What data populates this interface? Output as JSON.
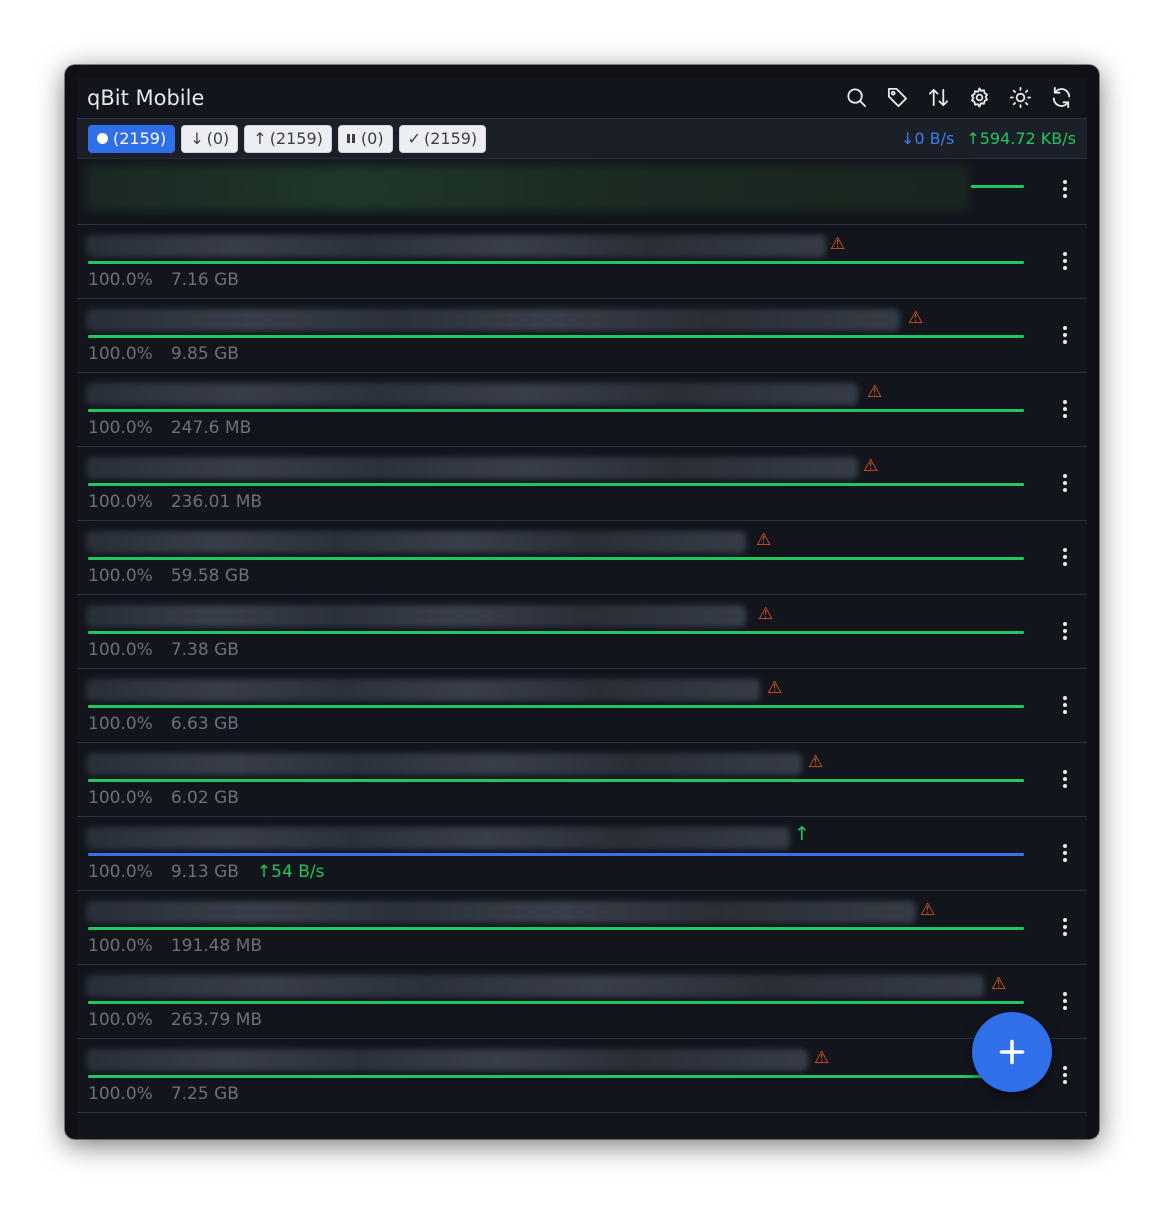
{
  "app": {
    "title": "qBit Mobile"
  },
  "toolbar": {
    "icons": [
      "search-icon",
      "tag-icon",
      "sort-icon",
      "settings-icon",
      "theme-icon",
      "refresh-icon"
    ]
  },
  "filters": {
    "all": "(2159)",
    "downloading": "(0)",
    "seeding": "(2159)",
    "paused": "(0)",
    "completed": "(2159)"
  },
  "speeds": {
    "download": "0 B/s",
    "upload": "594.72 KB/s"
  },
  "torrents": [
    {
      "status": "active",
      "progress": "",
      "size": "",
      "rate": ""
    },
    {
      "status": "warning",
      "progress": "100.0%",
      "size": "7.16 GB",
      "rate": ""
    },
    {
      "status": "warning",
      "progress": "100.0%",
      "size": "9.85 GB",
      "rate": ""
    },
    {
      "status": "warning",
      "progress": "100.0%",
      "size": "247.6 MB",
      "rate": ""
    },
    {
      "status": "warning",
      "progress": "100.0%",
      "size": "236.01 MB",
      "rate": ""
    },
    {
      "status": "warning",
      "progress": "100.0%",
      "size": "59.58 GB",
      "rate": ""
    },
    {
      "status": "warning",
      "progress": "100.0%",
      "size": "7.38 GB",
      "rate": ""
    },
    {
      "status": "warning",
      "progress": "100.0%",
      "size": "6.63 GB",
      "rate": ""
    },
    {
      "status": "warning",
      "progress": "100.0%",
      "size": "6.02 GB",
      "rate": ""
    },
    {
      "status": "uploading",
      "progress": "100.0%",
      "size": "9.13 GB",
      "rate": "54 B/s"
    },
    {
      "status": "warning",
      "progress": "100.0%",
      "size": "191.48 MB",
      "rate": ""
    },
    {
      "status": "warning",
      "progress": "100.0%",
      "size": "263.79 MB",
      "rate": ""
    },
    {
      "status": "warning",
      "progress": "100.0%",
      "size": "7.25 GB",
      "rate": ""
    }
  ],
  "colors": {
    "accent": "#2f6fea",
    "complete": "#22c55e",
    "warning": "#f0541e",
    "background": "#12151c"
  }
}
